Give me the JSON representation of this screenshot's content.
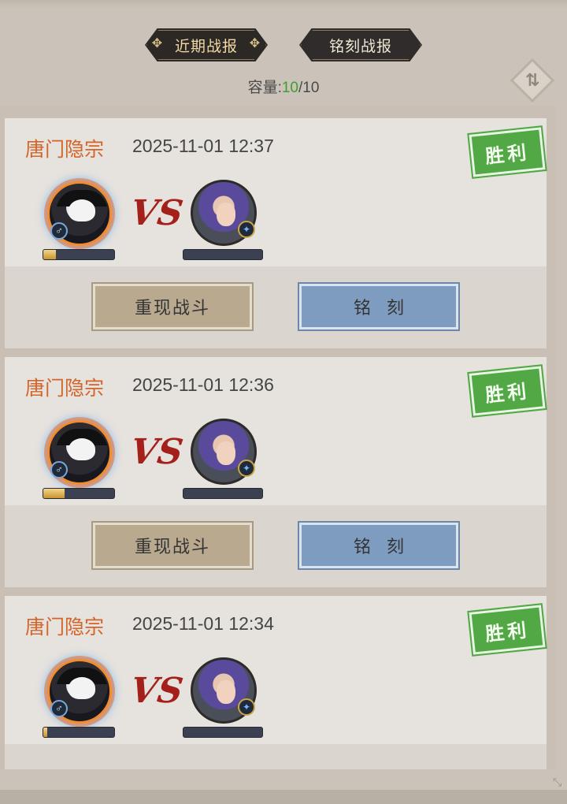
{
  "tabs": [
    {
      "label": "近期战报",
      "active": true
    },
    {
      "label": "铭刻战报",
      "active": false
    }
  ],
  "capacity": {
    "label": "容量:",
    "used": "10",
    "separator": "/",
    "total": "10"
  },
  "swap_icon": "swap-icon",
  "reports": [
    {
      "guild": "唐门隐宗",
      "time": "2025-11-01 12:37",
      "result": "胜利",
      "vs": "VS",
      "left_progress": 0.18,
      "right_progress": 0.0,
      "replay_label": "重现战斗",
      "engrave_label": "铭刻"
    },
    {
      "guild": "唐门隐宗",
      "time": "2025-11-01 12:36",
      "result": "胜利",
      "vs": "VS",
      "left_progress": 0.3,
      "right_progress": 0.0,
      "replay_label": "重现战斗",
      "engrave_label": "铭刻"
    },
    {
      "guild": "唐门隐宗",
      "time": "2025-11-01 12:34",
      "result": "胜利",
      "vs": "VS",
      "left_progress": 0.06,
      "right_progress": 0.0,
      "replay_label": "重现战斗",
      "engrave_label": "铭刻"
    }
  ],
  "colors": {
    "guild": "#d3652a",
    "victory_stamp": "#52a845",
    "capacity_used": "#3e9e2f",
    "replay_button": "#b8a98f",
    "engrave_button": "#7e9cc0"
  }
}
